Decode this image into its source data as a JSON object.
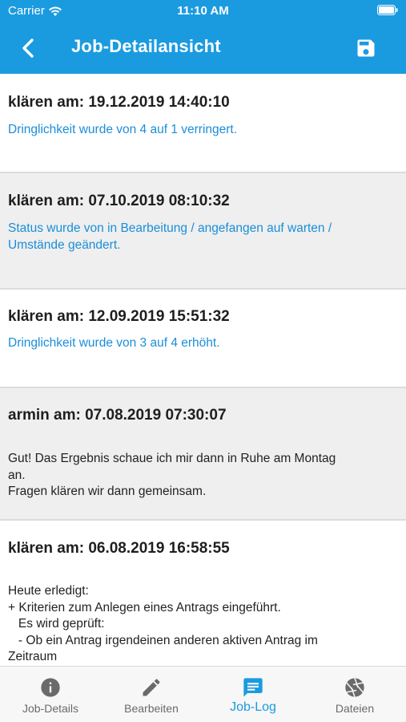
{
  "status_bar": {
    "carrier": "Carrier",
    "time": "11:10 AM"
  },
  "nav": {
    "title": "Job-Detailansicht",
    "back_icon": "chevron-left-icon",
    "save_icon": "floppy-disk-icon"
  },
  "entries": [
    {
      "header": "klären am: 19.12.2019 14:40:10",
      "message": "Dringlichkeit wurde von 4 auf 1 verringert.",
      "style": "blue"
    },
    {
      "header": "klären am: 07.10.2019 08:10:32",
      "message": "Status wurde von in Bearbeitung / angefangen auf warten /\nUmstände geändert.",
      "style": "blue"
    },
    {
      "header": "klären am: 12.09.2019 15:51:32",
      "message": "Dringlichkeit wurde von 3 auf 4 erhöht.",
      "style": "blue"
    },
    {
      "header": "armin am: 07.08.2019 07:30:07",
      "message": "Gut! Das Ergebnis schaue ich mir dann in Ruhe am Montag\nan.\nFragen klären wir dann gemeinsam.",
      "style": "dark"
    },
    {
      "header": "klären am: 06.08.2019 16:58:55",
      "message": "Heute erledigt:\n+ Kriterien zum Anlegen eines Antrags eingeführt.\n   Es wird geprüft:\n   - Ob ein Antrag irgendeinen anderen aktiven Antrag im\nZeitraum",
      "style": "dark"
    }
  ],
  "tabs": [
    {
      "label": "Job-Details",
      "icon": "info-icon",
      "active": false
    },
    {
      "label": "Bearbeiten",
      "icon": "pencil-icon",
      "active": false
    },
    {
      "label": "Job-Log",
      "icon": "message-icon",
      "active": true
    },
    {
      "label": "Dateien",
      "icon": "aperture-icon",
      "active": false
    }
  ],
  "colors": {
    "brand": "#1a9be0",
    "link_text": "#1a8ed9",
    "inactive_tab": "#6a6a6a"
  }
}
